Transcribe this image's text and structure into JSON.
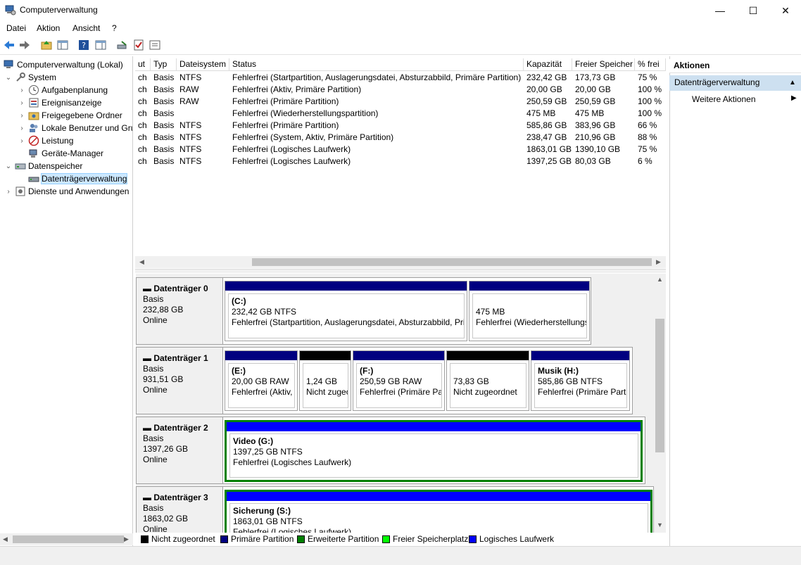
{
  "window": {
    "title": "Computerverwaltung",
    "min": "—",
    "max": "☐",
    "close": "✕"
  },
  "menu": [
    "Datei",
    "Aktion",
    "Ansicht",
    "?"
  ],
  "tree": {
    "root": "Computerverwaltung (Lokal)",
    "system": "System",
    "aufgaben": "Aufgabenplanung",
    "ereignis": "Ereignisanzeige",
    "freigaben": "Freigegebene Ordner",
    "benutzer": "Lokale Benutzer und Gruppen",
    "leistung": "Leistung",
    "geraete": "Geräte-Manager",
    "datenspeicher": "Datenspeicher",
    "datentraeger": "Datenträgerverwaltung",
    "dienste": "Dienste und Anwendungen"
  },
  "volumes": {
    "headers": [
      "ut",
      "Typ",
      "Dateisystem",
      "Status",
      "Kapazität",
      "Freier Speicher",
      "% frei"
    ],
    "rows": [
      [
        "ch",
        "Basis",
        "NTFS",
        "Fehlerfrei (Startpartition, Auslagerungsdatei, Absturzabbild, Primäre Partition)",
        "232,42 GB",
        "173,73 GB",
        "75 %"
      ],
      [
        "ch",
        "Basis",
        "RAW",
        "Fehlerfrei (Aktiv, Primäre Partition)",
        "20,00 GB",
        "20,00 GB",
        "100 %"
      ],
      [
        "ch",
        "Basis",
        "RAW",
        "Fehlerfrei (Primäre Partition)",
        "250,59 GB",
        "250,59 GB",
        "100 %"
      ],
      [
        "ch",
        "Basis",
        "",
        "Fehlerfrei (Wiederherstellungspartition)",
        "475 MB",
        "475 MB",
        "100 %"
      ],
      [
        "ch",
        "Basis",
        "NTFS",
        "Fehlerfrei (Primäre Partition)",
        "585,86 GB",
        "383,96 GB",
        "66 %"
      ],
      [
        "ch",
        "Basis",
        "NTFS",
        "Fehlerfrei (System, Aktiv, Primäre Partition)",
        "238,47 GB",
        "210,96 GB",
        "88 %"
      ],
      [
        "ch",
        "Basis",
        "NTFS",
        "Fehlerfrei (Logisches Laufwerk)",
        "1863,01 GB",
        "1390,10 GB",
        "75 %"
      ],
      [
        "ch",
        "Basis",
        "NTFS",
        "Fehlerfrei (Logisches Laufwerk)",
        "1397,25 GB",
        "80,03 GB",
        "6 %"
      ]
    ]
  },
  "disks": [
    {
      "name": "Datenträger 0",
      "type": "Basis",
      "size": "232,88 GB",
      "state": "Online",
      "parts": [
        {
          "name": "(C:)",
          "line1": "232,42 GB NTFS",
          "line2": "Fehlerfrei (Startpartition, Auslagerungsdatei, Absturzabbild, Primäre Partition)",
          "color": "#000080"
        },
        {
          "name": "",
          "line1": "475 MB",
          "line2": "Fehlerfrei (Wiederherstellungspartition)",
          "color": "#000080"
        }
      ]
    },
    {
      "name": "Datenträger 1",
      "type": "Basis",
      "size": "931,51 GB",
      "state": "Online",
      "parts": [
        {
          "name": "(E:)",
          "line1": "20,00 GB RAW",
          "line2": "Fehlerfrei (Aktiv, Primäre Partition)",
          "color": "#000080"
        },
        {
          "name": "",
          "line1": "1,24 GB",
          "line2": "Nicht zugeordnet",
          "color": "#000000"
        },
        {
          "name": "(F:)",
          "line1": "250,59 GB RAW",
          "line2": "Fehlerfrei (Primäre Partition)",
          "color": "#000080"
        },
        {
          "name": "",
          "line1": "73,83 GB",
          "line2": "Nicht zugeordnet",
          "color": "#000000"
        },
        {
          "name": "Musik  (H:)",
          "line1": "585,86 GB NTFS",
          "line2": "Fehlerfrei (Primäre Partition)",
          "color": "#000080"
        }
      ]
    },
    {
      "name": "Datenträger 2",
      "type": "Basis",
      "size": "1397,26 GB",
      "state": "Online",
      "parts": [
        {
          "name": "Video  (G:)",
          "line1": "1397,25 GB NTFS",
          "line2": "Fehlerfrei (Logisches Laufwerk)",
          "color": "#0000ff"
        }
      ]
    },
    {
      "name": "Datenträger 3",
      "type": "Basis",
      "size": "1863,02 GB",
      "state": "Online",
      "parts": [
        {
          "name": "Sicherung  (S:)",
          "line1": "1863,01 GB NTFS",
          "line2": "Fehlerfrei (Logisches Laufwerk)",
          "color": "#0000ff"
        }
      ]
    }
  ],
  "legend": [
    {
      "label": "Nicht zugeordnet",
      "color": "#000000"
    },
    {
      "label": "Primäre Partition",
      "color": "#000080"
    },
    {
      "label": "Erweiterte Partition",
      "color": "#008000"
    },
    {
      "label": "Freier Speicherplatz",
      "color": "#00ff00"
    },
    {
      "label": "Logisches Laufwerk",
      "color": "#0000ff"
    }
  ],
  "actions": {
    "header": "Aktionen",
    "section": "Datenträgerverwaltung",
    "more": "Weitere Aktionen"
  },
  "colors": {
    "extended": "#008000",
    "selection": "#cce8ff",
    "action_section": "#cde0f0"
  }
}
